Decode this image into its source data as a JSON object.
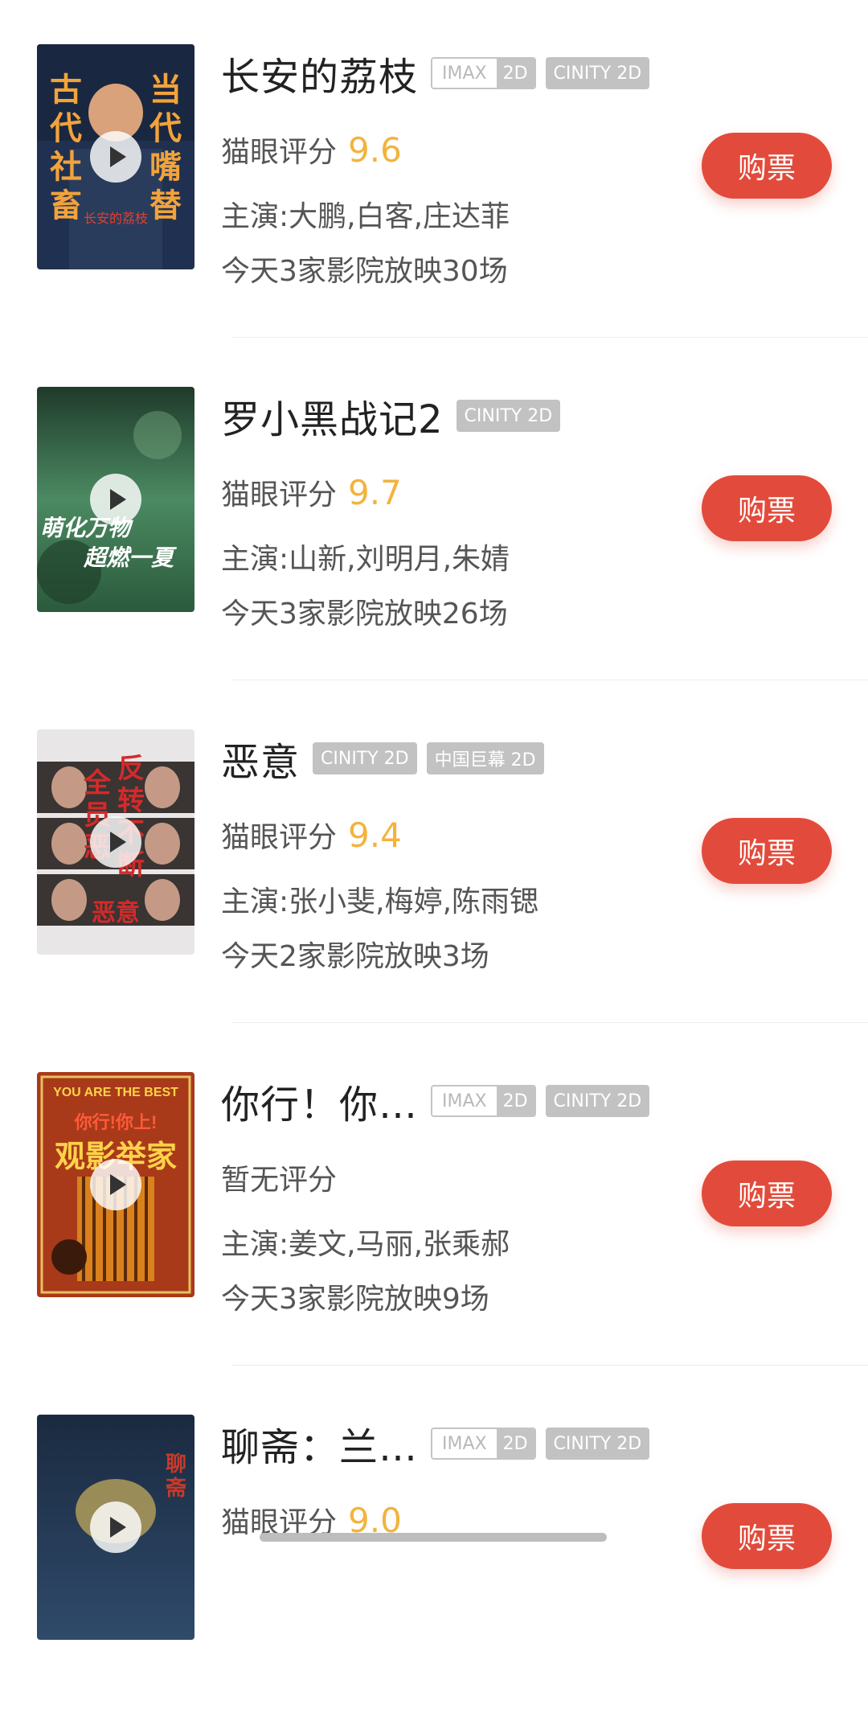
{
  "movies": [
    {
      "title": "长安的荔枝",
      "tags": [
        {
          "kind": "imax",
          "a": "IMAX",
          "b": "2D"
        },
        {
          "kind": "gray",
          "label": "CINITY 2D"
        }
      ],
      "rating_label": "猫眼评分",
      "rating": "9.6",
      "cast": "主演:大鹏,白客,庄达菲",
      "shows": "今天3家影院放映30场",
      "buy": "购票",
      "poster": {
        "left": [
          "古",
          "代",
          "社",
          "畜"
        ],
        "right": [
          "当",
          "代",
          "嘴",
          "替"
        ],
        "center": "长安的荔枝",
        "bg": "#203050",
        "text": "#f2a33a"
      }
    },
    {
      "title": "罗小黑战记2",
      "tags": [
        {
          "kind": "gray",
          "label": "CINITY 2D"
        }
      ],
      "rating_label": "猫眼评分",
      "rating": "9.7",
      "cast": "主演:山新,刘明月,朱婧",
      "shows": "今天3家影院放映26场",
      "buy": "购票",
      "poster": {
        "line1": "萌化万物",
        "line2": "超燃一夏",
        "bg": "#3d6b4b",
        "text": "#ffffff"
      }
    },
    {
      "title": "恶意",
      "tags": [
        {
          "kind": "gray",
          "label": "CINITY 2D"
        },
        {
          "kind": "gray",
          "label": "中国巨幕 2D"
        }
      ],
      "rating_label": "猫眼评分",
      "rating": "9.4",
      "cast": "主演:张小斐,梅婷,陈雨锶",
      "shows": "今天2家影院放映3场",
      "buy": "购票",
      "poster": {
        "left": [
          "全",
          "员",
          "恶"
        ],
        "right": [
          "反",
          "转",
          "不",
          "断"
        ],
        "bottom": "恶意",
        "bg": "#e8e6e6",
        "text": "#d42a2a"
      }
    },
    {
      "title": "你行！你…",
      "tags": [
        {
          "kind": "imax",
          "a": "IMAX",
          "b": "2D"
        },
        {
          "kind": "gray",
          "label": "CINITY 2D"
        }
      ],
      "rating_label": "暂无评分",
      "rating": "",
      "cast": "主演:姜文,马丽,张乘郝",
      "shows": "今天3家影院放映9场",
      "buy": "购票",
      "poster": {
        "top": "YOU ARE THE BEST",
        "mid": "你行!你上!",
        "main": "观影举家",
        "bg": "#a83a1a",
        "text": "#ffd24a"
      }
    },
    {
      "title": "聊斋：兰…",
      "tags": [
        {
          "kind": "imax",
          "a": "IMAX",
          "b": "2D"
        },
        {
          "kind": "gray",
          "label": "CINITY 2D"
        }
      ],
      "rating_label": "猫眼评分",
      "rating": "9.0",
      "cast": "",
      "shows": "",
      "buy": "购票",
      "poster": {
        "side": "聊斋",
        "bg": "#233047",
        "text": "#c83a2a"
      }
    }
  ]
}
